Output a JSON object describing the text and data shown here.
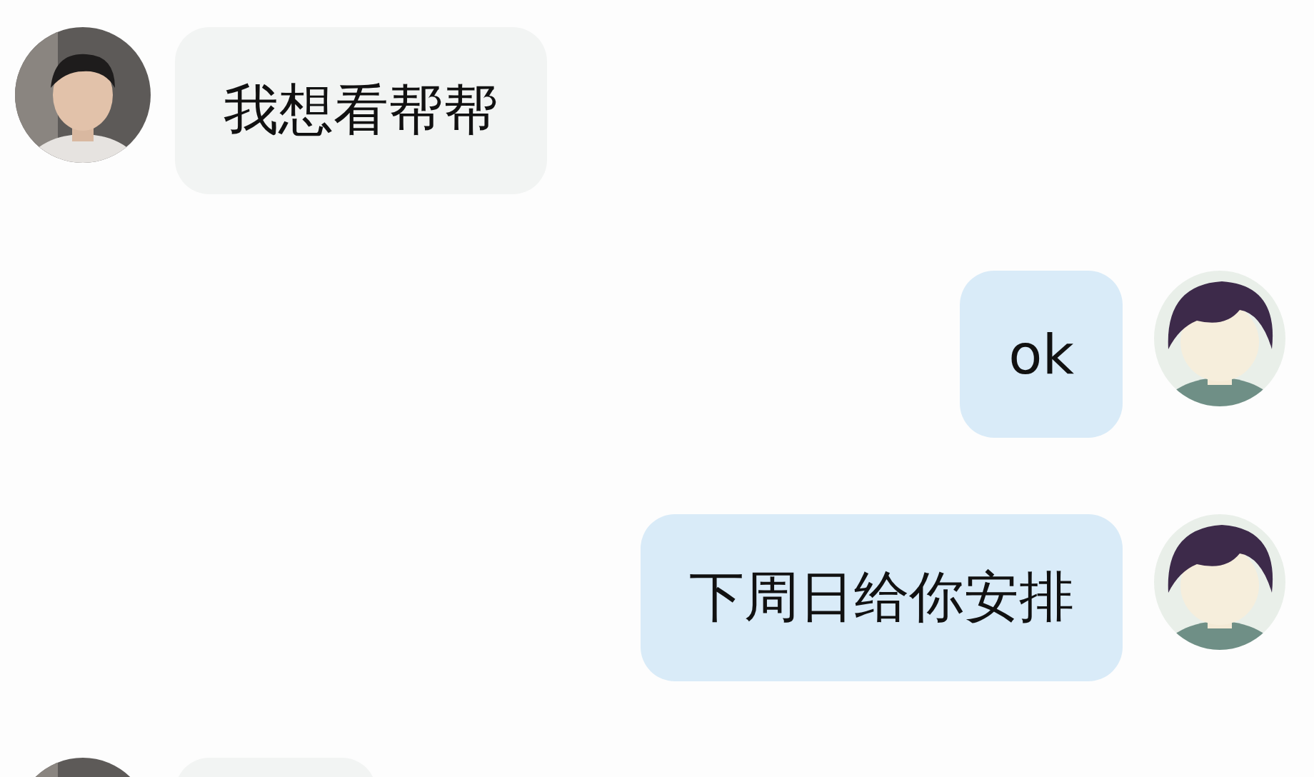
{
  "messages": [
    {
      "kind": "incoming",
      "text": "我想看帮帮"
    },
    {
      "kind": "outgoing",
      "text": "ok"
    },
    {
      "kind": "outgoing",
      "text": "下周日给你安排"
    },
    {
      "kind": "incoming"
    }
  ]
}
